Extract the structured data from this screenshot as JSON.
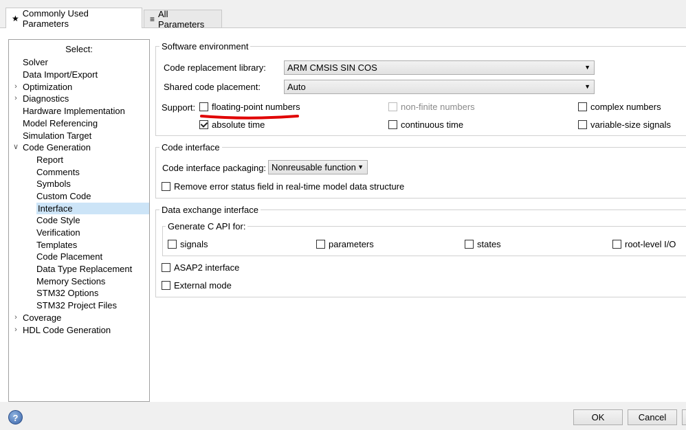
{
  "tabs": [
    {
      "icon": "star-icon",
      "glyph": "★",
      "label": "Commonly Used Parameters"
    },
    {
      "icon": "list-icon",
      "glyph": "≡",
      "label": "All Parameters"
    }
  ],
  "tree": {
    "heading": "Select:",
    "items": [
      {
        "label": "Solver",
        "expander": ""
      },
      {
        "label": "Data Import/Export",
        "expander": ""
      },
      {
        "label": "Optimization",
        "expander": ">"
      },
      {
        "label": "Diagnostics",
        "expander": ">"
      },
      {
        "label": "Hardware Implementation",
        "expander": ""
      },
      {
        "label": "Model Referencing",
        "expander": ""
      },
      {
        "label": "Simulation Target",
        "expander": ""
      },
      {
        "label": "Code Generation",
        "expander": "v"
      },
      {
        "label": "Report",
        "expander": ""
      },
      {
        "label": "Comments",
        "expander": ""
      },
      {
        "label": "Symbols",
        "expander": ""
      },
      {
        "label": "Custom Code",
        "expander": ""
      },
      {
        "label": "Interface",
        "expander": "",
        "selected": true
      },
      {
        "label": "Code Style",
        "expander": ""
      },
      {
        "label": "Verification",
        "expander": ""
      },
      {
        "label": "Templates",
        "expander": ""
      },
      {
        "label": "Code Placement",
        "expander": ""
      },
      {
        "label": "Data Type Replacement",
        "expander": ""
      },
      {
        "label": "Memory Sections",
        "expander": ""
      },
      {
        "label": "STM32 Options",
        "expander": ""
      },
      {
        "label": "STM32 Project Files",
        "expander": ""
      },
      {
        "label": "Coverage",
        "expander": ">"
      },
      {
        "label": "HDL Code Generation",
        "expander": ">"
      }
    ]
  },
  "software_env": {
    "title": "Software environment",
    "code_replacement_label": "Code replacement library:",
    "code_replacement_value": "ARM CMSIS SIN COS",
    "shared_code_label": "Shared code placement:",
    "shared_code_value": "Auto",
    "support_label": "Support:",
    "floating_point": {
      "label": "floating-point numbers",
      "checked": false
    },
    "non_finite": {
      "label": "non-finite numbers",
      "checked": false,
      "disabled": true
    },
    "complex": {
      "label": "complex numbers",
      "checked": false
    },
    "absolute_time": {
      "label": "absolute time",
      "checked": true
    },
    "continuous_time": {
      "label": "continuous time",
      "checked": false
    },
    "variable_size": {
      "label": "variable-size signals",
      "checked": false
    }
  },
  "code_interface": {
    "title": "Code interface",
    "packaging_label": "Code interface packaging:",
    "packaging_value": "Nonreusable function",
    "remove_error": {
      "label": "Remove error status field in real-time model data structure",
      "checked": false
    }
  },
  "data_exchange": {
    "title": "Data exchange interface",
    "capi_title": "Generate C API for:",
    "signals": {
      "label": "signals",
      "checked": false
    },
    "parameters": {
      "label": "parameters",
      "checked": false
    },
    "states": {
      "label": "states",
      "checked": false
    },
    "root_io": {
      "label": "root-level I/O",
      "checked": false
    },
    "asap2": {
      "label": "ASAP2 interface",
      "checked": false
    },
    "external_mode": {
      "label": "External mode",
      "checked": false
    }
  },
  "annotation": {
    "color": "#e00000"
  },
  "footer": {
    "help_glyph": "?",
    "ok_label": "OK",
    "cancel_label": "Cancel"
  }
}
